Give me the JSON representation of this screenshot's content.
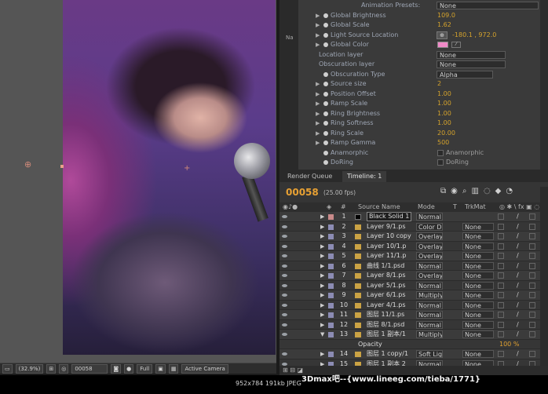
{
  "viewer": {
    "zoom": "(32.9%)",
    "frame": "00058",
    "resolution": "Full",
    "camera": "Active Camera"
  },
  "effects": {
    "rows": [
      {
        "name": "Animation Presets:",
        "dropdown": "None",
        "kind": "preset"
      },
      {
        "name": "Global Brightness",
        "value": "109.0"
      },
      {
        "name": "Global Scale",
        "value": "1.62"
      },
      {
        "name": "Light Source Location",
        "value": "-180.1 , 972.0",
        "kind": "point"
      },
      {
        "name": "Global Color",
        "kind": "color",
        "color": "#f08ac8"
      },
      {
        "name": "Location layer",
        "dropdown": "None",
        "kind": "layer"
      },
      {
        "name": "Obscuration layer",
        "dropdown": "None",
        "kind": "layer"
      },
      {
        "name": "Obscuration Type",
        "dropdown": "Alpha",
        "kind": "type"
      },
      {
        "name": "Source size",
        "value": "2"
      },
      {
        "name": "Position Offset",
        "value": "1.00"
      },
      {
        "name": "Ramp Scale",
        "value": "1.00"
      },
      {
        "name": "Ring Brightness",
        "value": "1.00"
      },
      {
        "name": "Ring Softness",
        "value": "1.00"
      },
      {
        "name": "Ring Scale",
        "value": "20.00"
      },
      {
        "name": "Ramp Gamma",
        "value": "500"
      },
      {
        "name": "Anamorphic",
        "check": "Anamorphic",
        "kind": "check"
      },
      {
        "name": "DoRing",
        "check": "DoRing",
        "kind": "check"
      }
    ]
  },
  "timeline": {
    "tabs": [
      "Render Queue",
      "Timeline: 1"
    ],
    "timecode": "00058",
    "fps": "(25.00 fps)",
    "headers": {
      "source": "Source Name",
      "mode": "Mode",
      "t": "T",
      "trkmat": "TrkMat"
    },
    "layers": [
      {
        "num": "1",
        "name": "Black Solid 1",
        "mode": "Normal",
        "trk": "",
        "color": "#c98a8a",
        "solid": true
      },
      {
        "num": "2",
        "name": "Layer 9/1.ps",
        "mode": "Color D",
        "trk": "None",
        "color": "#8c8cb4"
      },
      {
        "num": "3",
        "name": "Layer 10 copy",
        "mode": "Overlay",
        "trk": "None",
        "color": "#8c8cb4"
      },
      {
        "num": "4",
        "name": "Layer 10/1.p",
        "mode": "Overlay",
        "trk": "None",
        "color": "#8c8cb4"
      },
      {
        "num": "5",
        "name": "Layer 11/1.p",
        "mode": "Overlay",
        "trk": "None",
        "color": "#8c8cb4"
      },
      {
        "num": "6",
        "name": "曲线 1/1.psd",
        "mode": "Normal",
        "trk": "None",
        "color": "#8c8cb4"
      },
      {
        "num": "7",
        "name": "Layer 8/1.ps",
        "mode": "Overlay",
        "trk": "None",
        "color": "#8c8cb4"
      },
      {
        "num": "8",
        "name": "Layer 5/1.ps",
        "mode": "Normal",
        "trk": "None",
        "color": "#8c8cb4"
      },
      {
        "num": "9",
        "name": "Layer 6/1.ps",
        "mode": "Multiply",
        "trk": "None",
        "color": "#8c8cb4"
      },
      {
        "num": "10",
        "name": "Layer 4/1.ps",
        "mode": "Normal",
        "trk": "None",
        "color": "#8c8cb4"
      },
      {
        "num": "11",
        "name": "图层 11/1.ps",
        "mode": "Normal",
        "trk": "None",
        "color": "#8c8cb4"
      },
      {
        "num": "12",
        "name": "图层 8/1.psd",
        "mode": "Normal",
        "trk": "None",
        "color": "#8c8cb4"
      },
      {
        "num": "13",
        "name": "图层 1 副本/1",
        "mode": "Multiply",
        "trk": "None",
        "color": "#8c8cb4"
      },
      {
        "num": "",
        "name": "Opacity",
        "mode": "",
        "trk": "",
        "color": "",
        "property": true,
        "value": "100 %"
      },
      {
        "num": "14",
        "name": "图层 1 copy/1",
        "mode": "Soft Lig",
        "trk": "None",
        "color": "#8c8cb4"
      },
      {
        "num": "15",
        "name": "图层 1 副本 2",
        "mode": "Normal",
        "trk": "None",
        "color": "#8c8cb4"
      }
    ]
  },
  "footer": {
    "info": "952x784  191kb  JPEG",
    "watermark": "3Dmax吧--{www.lineeg.com/tieba/1771}"
  }
}
